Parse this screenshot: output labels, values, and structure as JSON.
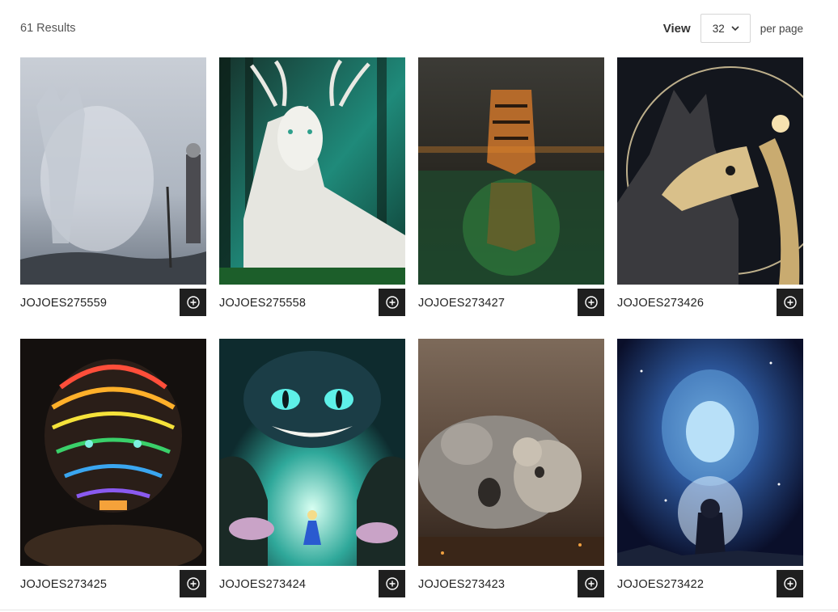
{
  "toolbar": {
    "results_text": "61 Results",
    "view_label": "View",
    "per_page_value": "32",
    "per_page_label": "per page"
  },
  "products": [
    {
      "sku": "JOJOES275559",
      "art": "wolf-mist"
    },
    {
      "sku": "JOJOES275558",
      "art": "white-stag"
    },
    {
      "sku": "JOJOES273427",
      "art": "tiger-reflection"
    },
    {
      "sku": "JOJOES273426",
      "art": "wolf-skeleton"
    },
    {
      "sku": "JOJOES273425",
      "art": "neon-tiger"
    },
    {
      "sku": "JOJOES273424",
      "art": "cheshire-alice"
    },
    {
      "sku": "JOJOES273423",
      "art": "koala-family"
    },
    {
      "sku": "JOJOES273422",
      "art": "cosmic-lion"
    }
  ],
  "colors": {
    "add_button": "#1f1f1f",
    "text_muted": "#555555"
  }
}
